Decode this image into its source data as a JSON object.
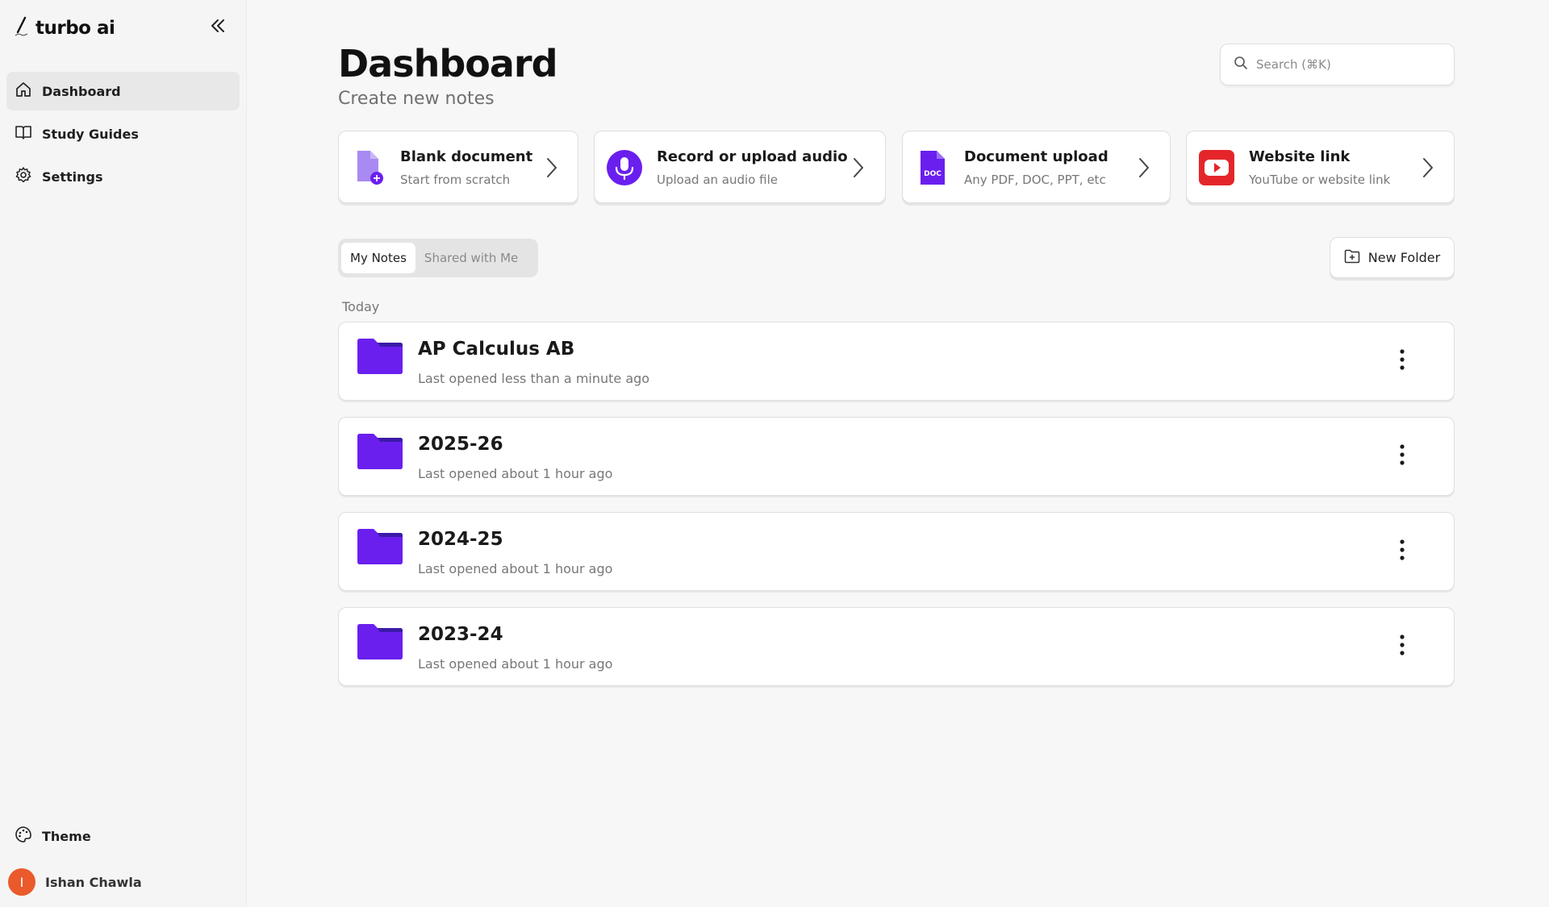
{
  "app": {
    "brand": "turbo ai"
  },
  "sidebar": {
    "items": [
      {
        "label": "Dashboard",
        "icon": "home-icon",
        "active": true
      },
      {
        "label": "Study Guides",
        "icon": "book-icon",
        "active": false
      },
      {
        "label": "Settings",
        "icon": "gear-icon",
        "active": false
      }
    ],
    "theme_label": "Theme",
    "user": {
      "name": "Ishan Chawla",
      "initial": "I",
      "avatar_color": "#ea5a2b"
    }
  },
  "header": {
    "title": "Dashboard",
    "subtitle": "Create new notes",
    "search_placeholder": "Search (⌘K)"
  },
  "create_cards": [
    {
      "title": "Blank document",
      "description": "Start from scratch",
      "icon": "blank-document-icon"
    },
    {
      "title": "Record or upload audio",
      "description": "Upload an audio file",
      "icon": "microphone-icon"
    },
    {
      "title": "Document upload",
      "description": "Any PDF, DOC, PPT, etc",
      "icon": "doc-file-icon",
      "icon_text": "DOC"
    },
    {
      "title": "Website link",
      "description": "YouTube or website link",
      "icon": "youtube-icon"
    }
  ],
  "tabs": [
    {
      "label": "My Notes",
      "active": true
    },
    {
      "label": "Shared with Me",
      "active": false
    }
  ],
  "new_folder_label": "New Folder",
  "section_label": "Today",
  "folders": [
    {
      "title": "AP Calculus AB",
      "subtitle": "Last opened less than a minute ago"
    },
    {
      "title": "2025-26",
      "subtitle": "Last opened about 1 hour ago"
    },
    {
      "title": "2024-25",
      "subtitle": "Last opened about 1 hour ago"
    },
    {
      "title": "2023-24",
      "subtitle": "Last opened about 1 hour ago"
    }
  ],
  "colors": {
    "accent": "#6a1fef",
    "folder": "#6a1fef",
    "folder_tab": "#3c1aa8",
    "youtube": "#e4262a"
  }
}
